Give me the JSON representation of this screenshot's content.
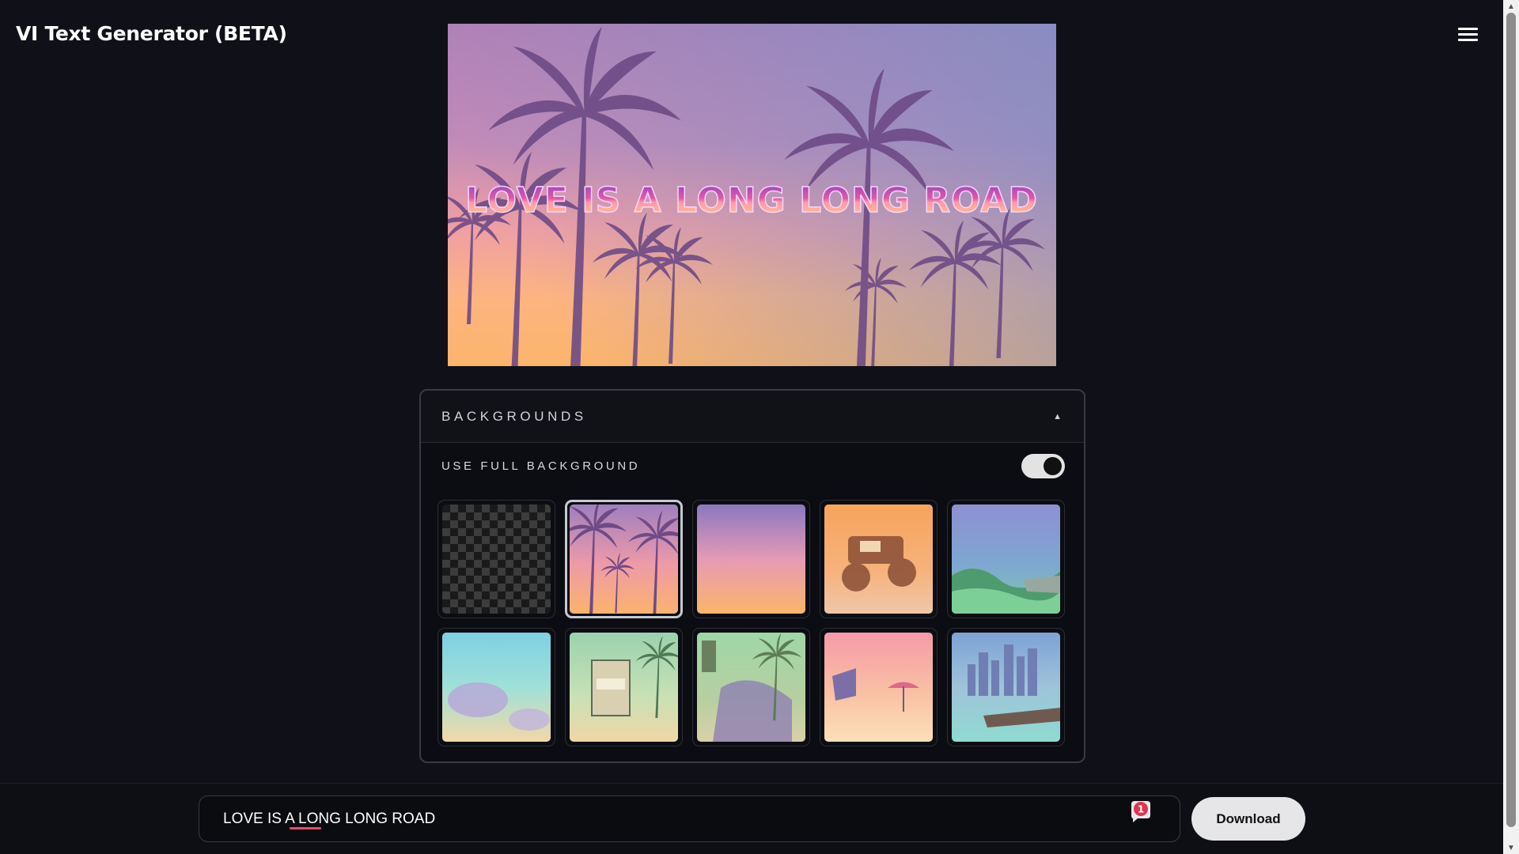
{
  "header": {
    "app_title": "VI Text Generator (BETA)",
    "menu_icon": "hamburger-menu-icon"
  },
  "preview": {
    "headline": "LOVE IS A LONG LONG ROAD",
    "background": "palm-sunset"
  },
  "backgrounds_panel": {
    "title": "BACKGROUNDS",
    "collapse_icon": "caret-up-icon",
    "toggle_label": "USE FULL BACKGROUND",
    "toggle_on": true,
    "selected_index": 1,
    "tiles": [
      {
        "name": "transparent"
      },
      {
        "name": "palm-sunset"
      },
      {
        "name": "gradient-sunset"
      },
      {
        "name": "monster-truck"
      },
      {
        "name": "jungle-lake"
      },
      {
        "name": "beach-shell"
      },
      {
        "name": "sign-street"
      },
      {
        "name": "motel-palms"
      },
      {
        "name": "beach-lifeguard"
      },
      {
        "name": "city-pier"
      }
    ]
  },
  "bottom_bar": {
    "text_value": "LOVE IS A LONG LONG ROAD",
    "extension_badge_count": "1",
    "download_label": "Download"
  },
  "colors": {
    "page_bg": "#101118",
    "accent_pink": "#e84b6a",
    "button_bg": "#e6e6e8"
  }
}
